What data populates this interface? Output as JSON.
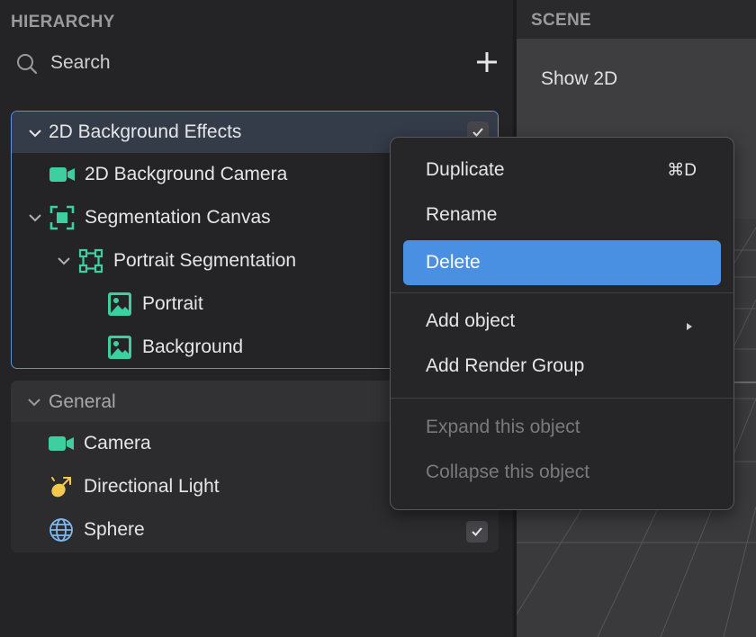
{
  "hierarchy": {
    "title": "HIERARCHY",
    "search_placeholder": "Search",
    "add_icon": "plus-icon",
    "groups": [
      {
        "name": "2D Background Effects",
        "expanded": true,
        "checked": true,
        "items": [
          {
            "label": "2D Background Camera",
            "icon": "camera-icon"
          },
          {
            "label": "Segmentation Canvas",
            "icon": "canvas-icon",
            "expanded": true
          },
          {
            "label": "Portrait Segmentation",
            "icon": "segmentation-icon",
            "expanded": true
          },
          {
            "label": "Portrait",
            "icon": "image-icon"
          },
          {
            "label": "Background",
            "icon": "image-icon"
          }
        ]
      },
      {
        "name": "General",
        "expanded": true,
        "items": [
          {
            "label": "Camera",
            "icon": "camera-icon"
          },
          {
            "label": "Directional Light",
            "icon": "light-icon"
          },
          {
            "label": "Sphere",
            "icon": "sphere-icon",
            "checked": true
          }
        ]
      }
    ]
  },
  "scene": {
    "title": "SCENE",
    "show_2d": "Show 2D"
  },
  "context_menu": {
    "items": [
      {
        "label": "Duplicate",
        "shortcut": "⌘D"
      },
      {
        "label": "Rename"
      },
      {
        "label": "Delete",
        "active": true
      },
      {
        "label": "Add object",
        "submenu": true
      },
      {
        "label": "Add Render Group"
      },
      {
        "label": "Expand this object",
        "disabled": true
      },
      {
        "label": "Collapse this object",
        "disabled": true
      }
    ]
  },
  "colors": {
    "accent": "#4a90e2",
    "selection_border": "#5b93d6",
    "icon_teal": "#3ecf9f",
    "icon_light": "#f2c94c",
    "icon_sphere": "#7fb8f0"
  }
}
